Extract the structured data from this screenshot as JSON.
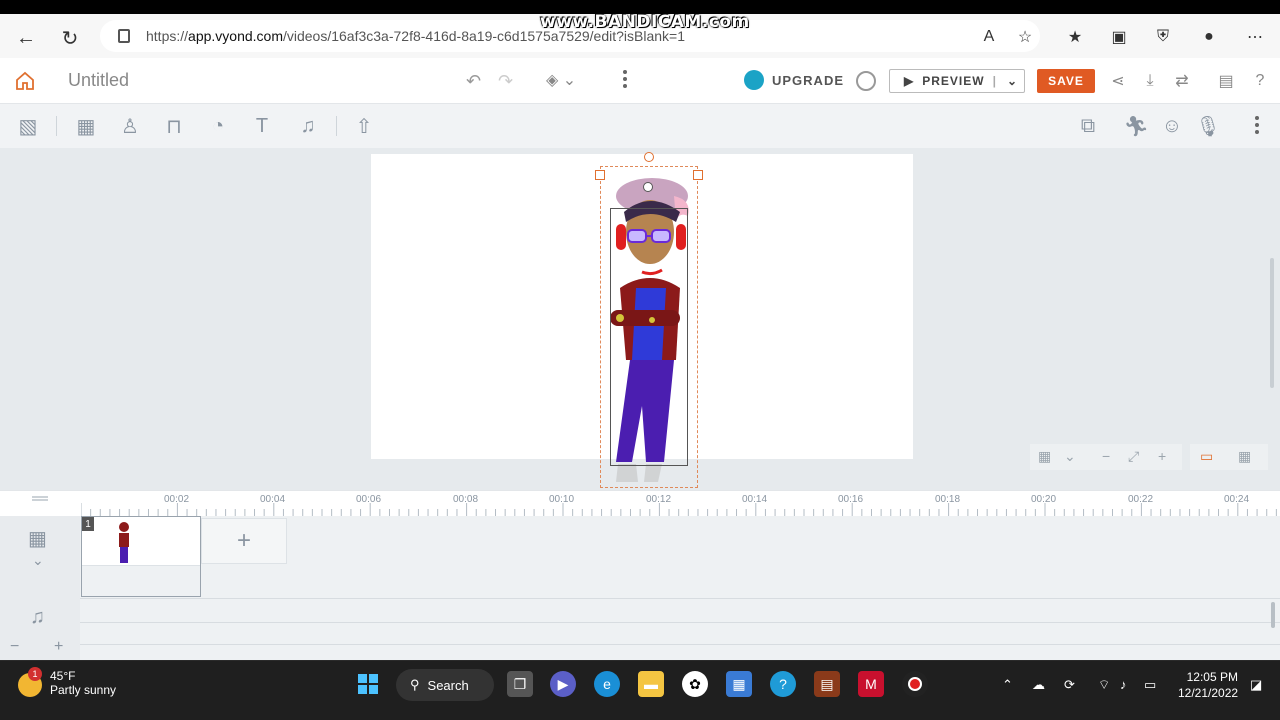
{
  "browser": {
    "url_prefix": "https://",
    "url_host": "app.vyond.com",
    "url_path": "/videos/16af3c3a-72f8-416d-8a19-c6d1575a7529/edit?isBlank=1",
    "watermark": "www.BANDICAM.com"
  },
  "app": {
    "title": "Untitled",
    "upgrade_label": "UPGRADE",
    "preview_label": "PREVIEW",
    "save_label": "SAVE",
    "accent_color": "#e05a23",
    "upgrade_color": "#1ba3c6"
  },
  "timeline": {
    "tick_labels": [
      "00:02",
      "00:04",
      "00:06",
      "00:08",
      "00:10",
      "00:12",
      "00:14",
      "00:16",
      "00:18",
      "00:20",
      "00:22",
      "00:24"
    ],
    "scene_number": "1",
    "add_scene": "+",
    "audio_minus": "−",
    "audio_plus": "+"
  },
  "taskbar": {
    "weather_badge": "1",
    "weather_temp": "45°F",
    "weather_desc": "Partly sunny",
    "search_label": "Search",
    "time": "12:05 PM",
    "date": "12/21/2022"
  }
}
